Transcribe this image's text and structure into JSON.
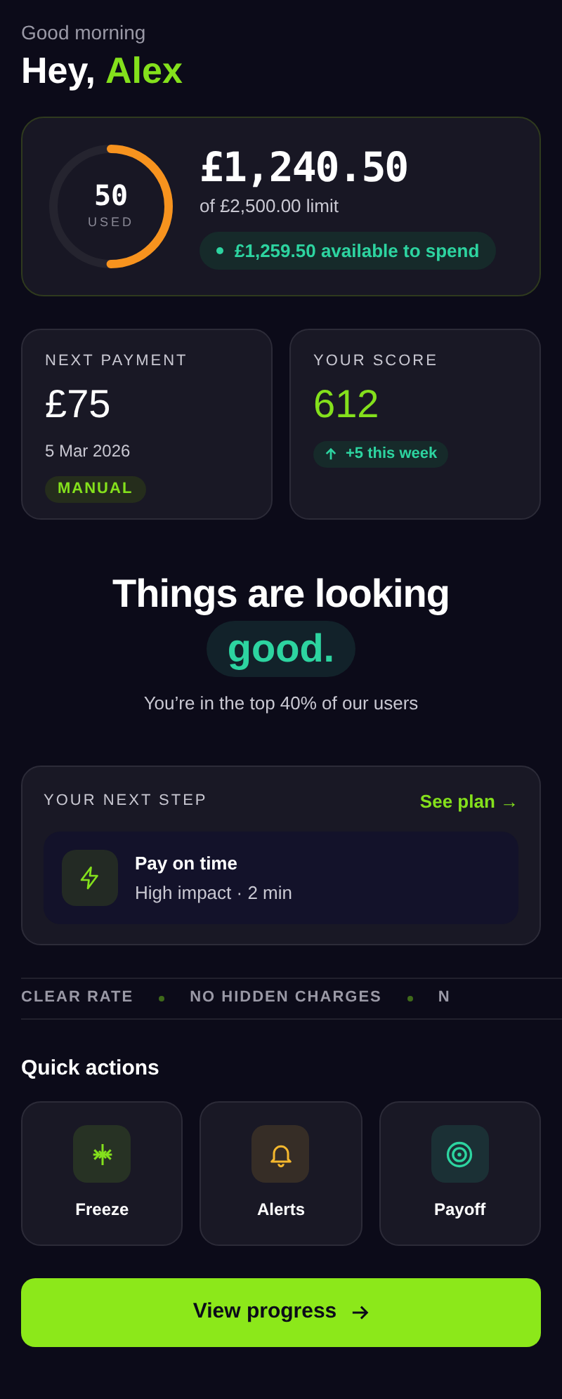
{
  "greeting": "Good morning",
  "headline": {
    "prefix": "Hey,",
    "name": "Alex"
  },
  "credit": {
    "usage_value": "50",
    "usage_label": "USED",
    "level": 0.5,
    "balance": "£1,240.50",
    "limit": "of £2,500.00 limit",
    "available": "£1,259.50 available to spend"
  },
  "stats": [
    {
      "kind": "payment",
      "label": "NEXT PAYMENT",
      "value": "£75",
      "date": "5 Mar 2026",
      "badge": "MANUAL"
    },
    {
      "kind": "score",
      "label": "YOUR SCORE",
      "value": "612",
      "badge": "+5 this week"
    }
  ],
  "summary": {
    "line": "Things are looking",
    "highlight": "good.",
    "subtitle": "You’re in the top 40% of our users"
  },
  "next_step": {
    "label": "YOUR NEXT STEP",
    "link": "See plan →",
    "title": "Pay on time",
    "detail": "High impact · 2 min"
  },
  "ticker": [
    "CLEAR RATE",
    "NO HIDDEN CHARGES",
    "N"
  ],
  "quick_actions_title": "Quick actions",
  "quick_actions": [
    {
      "kind": "freeze",
      "label": "Freeze",
      "color": "#84e01c"
    },
    {
      "kind": "alerts",
      "label": "Alerts",
      "color": "#f5b82e"
    },
    {
      "kind": "payoff",
      "label": "Payoff",
      "color": "#2dd4a0"
    }
  ],
  "primary_button": "View progress"
}
